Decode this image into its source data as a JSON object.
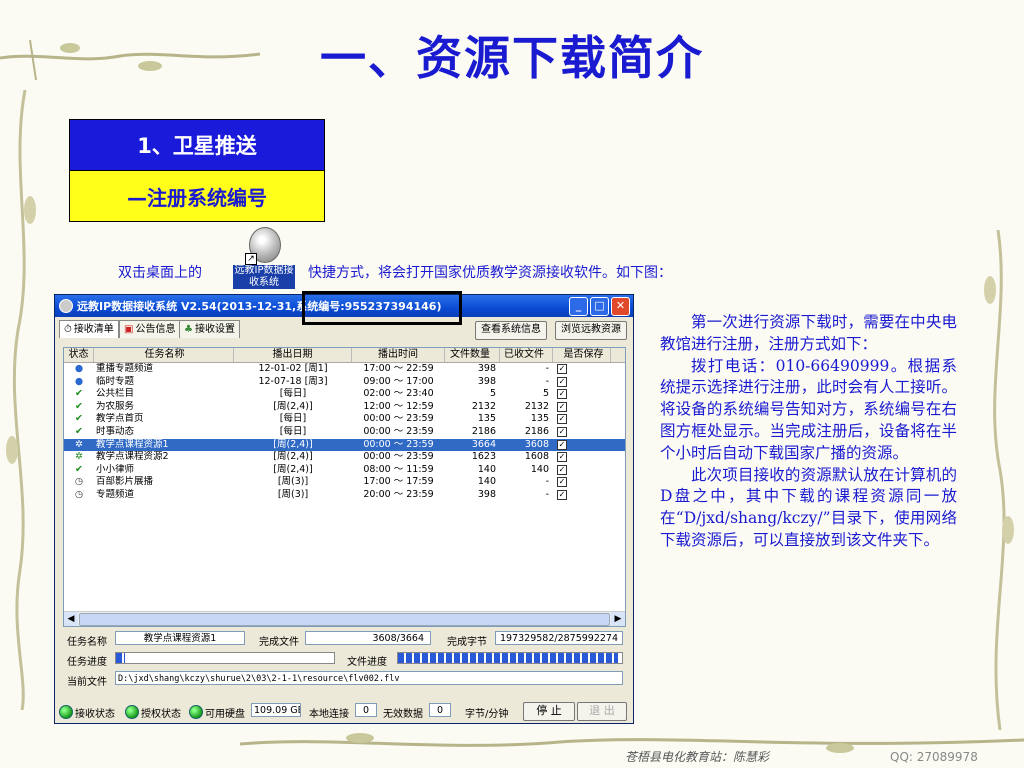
{
  "slide": {
    "title": "一、资源下载简介",
    "heading1": "1、卫星推送",
    "heading2": "—注册系统编号",
    "intro_before": "双击桌面上的",
    "intro_after": "快捷方式，将会打开国家优质教学资源接收软件。如下图：",
    "desktop_icon_label": "远教IP数据接收系统",
    "side_paragraphs": [
      "第一次进行资源下载时，需要在中央电教馆进行注册，注册方式如下：",
      "拨打电话：010-66490999。根据系统提示选择进行注册，此时会有人工接听。将设备的系统编号告知对方，系统编号在右图方框处显示。当完成注册后，设备将在半个小时后自动下载国家广播的资源。",
      "此次项目接收的资源默认放在计算机的 D盘之中，其中下载的课程资源同一放在“D/jxd/shang/kczy/”目录下，使用网络下载资源后，可以直接放到该文件夹下。"
    ],
    "footer": "苍梧县电化教育站：陈慧彩",
    "qq": "QQ: 27089978",
    "colors": {
      "title_blue": "#1a1ad0",
      "box_blue": "#1a1adb",
      "box_yellow": "#ffff1a"
    }
  },
  "window": {
    "title": "远教IP数据接收系统 V2.54(2013-12-31,系统编号:955237394146)",
    "tabs": [
      "接收清单",
      "公告信息",
      "接收设置"
    ],
    "btn_view_info": "查看系统信息",
    "btn_browse": "浏览远教资源",
    "columns": [
      "状态",
      "任务名称",
      "播出日期",
      "播出时间",
      "文件数量",
      "已收文件",
      "是否保存"
    ],
    "rows": [
      {
        "status": "globe",
        "name": "重播专题频道",
        "date": "12-01-02 [周1]",
        "time": "17:00 ～ 22:59",
        "count": "398",
        "received": "-",
        "save": "✓",
        "selected": false
      },
      {
        "status": "globe",
        "name": "临时专题",
        "date": "12-07-18 [周3]",
        "time": "09:00 ～ 17:00",
        "count": "398",
        "received": "-",
        "save": "✓",
        "selected": false
      },
      {
        "status": "check",
        "name": "公共栏目",
        "date": "[每日]",
        "time": "02:00 ～ 23:40",
        "count": "5",
        "received": "5",
        "save": "✓",
        "selected": false
      },
      {
        "status": "check",
        "name": "为农服务",
        "date": "[周(2,4)]",
        "time": "12:00 ～ 12:59",
        "count": "2132",
        "received": "2132",
        "save": "✓",
        "selected": false
      },
      {
        "status": "check",
        "name": "教学点首页",
        "date": "[每日]",
        "time": "00:00 ～ 23:59",
        "count": "135",
        "received": "135",
        "save": "✓",
        "selected": false
      },
      {
        "status": "check",
        "name": "时事动态",
        "date": "[每日]",
        "time": "00:00 ～ 23:59",
        "count": "2186",
        "received": "2186",
        "save": "✓",
        "selected": false
      },
      {
        "status": "run",
        "name": "教学点课程资源1",
        "date": "[周(2,4)]",
        "time": "00:00 ～ 23:59",
        "count": "3664",
        "received": "3608",
        "save": "✓",
        "selected": true
      },
      {
        "status": "run",
        "name": "教学点课程资源2",
        "date": "[周(2,4)]",
        "time": "00:00 ～ 23:59",
        "count": "1623",
        "received": "1608",
        "save": "✓",
        "selected": false
      },
      {
        "status": "check",
        "name": "小小律师",
        "date": "[周(2,4)]",
        "time": "08:00 ～ 11:59",
        "count": "140",
        "received": "140",
        "save": "✓",
        "selected": false
      },
      {
        "status": "clock",
        "name": "百部影片展播",
        "date": "[周(3)]",
        "time": "17:00 ～ 17:59",
        "count": "140",
        "received": "-",
        "save": "✓",
        "selected": false
      },
      {
        "status": "clock",
        "name": "专题频道",
        "date": "[周(3)]",
        "time": "20:00 ～ 23:59",
        "count": "398",
        "received": "-",
        "save": "✓",
        "selected": false
      }
    ],
    "task_name_label": "任务名称",
    "task_name_value": "教学点课程资源1",
    "done_files_label": "完成文件",
    "done_files_value": "3608/3664",
    "done_bytes_label": "完成字节",
    "done_bytes_value": "197329582/2875992274",
    "task_progress_label": "任务进度",
    "task_progress": 0.04,
    "file_progress_label": "文件进度",
    "file_progress": 0.98,
    "current_file_label": "当前文件",
    "current_file_value": "D:\\jxd\\shang\\kczy\\shurue\\2\\03\\2-1-1\\resource\\flv002.flv",
    "status_receive": "接收状态",
    "status_auth": "授权状态",
    "status_disk": "可用硬盘",
    "disk_value": "109.09",
    "disk_unit": "GB",
    "local_conn_label": "本地连接",
    "local_conn_value": "0",
    "invalid_label": "无效数据",
    "invalid_value": "0",
    "rate_label": "字节/分钟",
    "btn_stop": "停 止",
    "btn_exit": "退 出"
  }
}
